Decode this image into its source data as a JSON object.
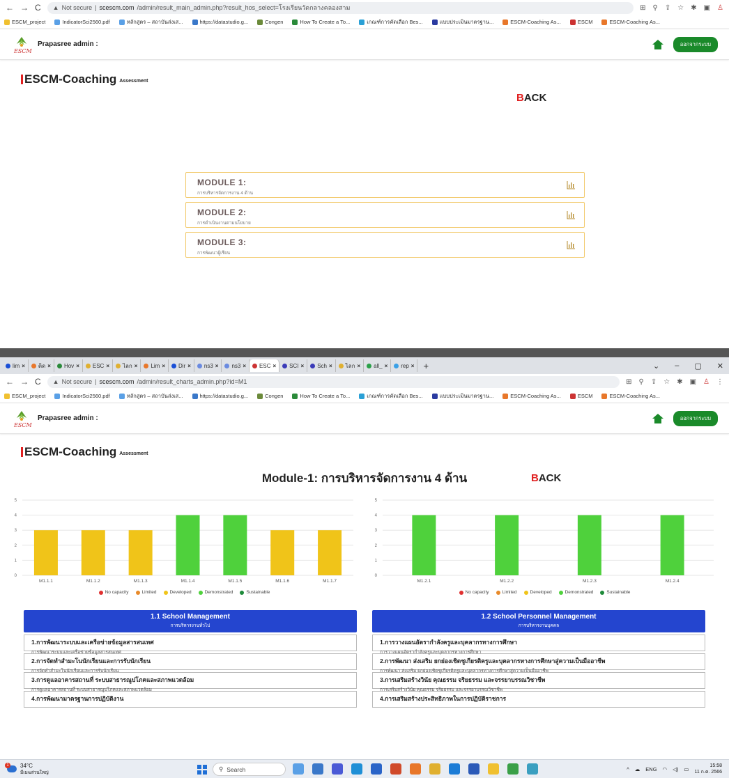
{
  "shot1": {
    "url_insecure": "Not secure",
    "url_host": "scescm.com",
    "url_path": "/admin/result_main_admin.php?result_hos_select=โรงเรียนวัดกลางคลองสาม",
    "bookmarks": [
      "ESCM_project",
      "IndicatorSci2560.pdf",
      "หลักสูตร – สถาบันส่งเส...",
      "https://datastudio.g...",
      "Congen",
      "How To Create a To...",
      "เกณฑ์การคัดเลือก Bes...",
      "แบบประเมินมาตรฐาน...",
      "ESCM-Coaching As...",
      "ESCM",
      "ESCM-Coaching As..."
    ],
    "admin_label": "Prapasree admin :",
    "logout_label": "ออกจากระบบ",
    "brand_name": "ESCM-Coaching",
    "brand_sub": "Assessment",
    "back_first": "B",
    "back_rest": "ACK",
    "modules": [
      {
        "title": "MODULE 1:",
        "subtitle": "การบริหารจัดการงาน 4 ด้าน"
      },
      {
        "title": "MODULE 2:",
        "subtitle": "การดำเนินงานตามนโยบาย"
      },
      {
        "title": "MODULE 3:",
        "subtitle": "การพัฒนาผู้เรียน"
      }
    ]
  },
  "shot2": {
    "tabs": [
      "lim",
      "ติด",
      "Hov",
      "ESC",
      "ไลก",
      "Lim",
      "Dir",
      "ns3",
      "ns3",
      "ESC",
      "SCI",
      "Sch",
      "ไลก",
      "all_",
      "rep"
    ],
    "url_insecure": "Not secure",
    "url_host": "scescm.com",
    "url_path": "/admin/result_charts_admin.php?id=M1",
    "bookmarks": [
      "ESCM_project",
      "IndicatorSci2560.pdf",
      "หลักสูตร – สถาบันส่งเส...",
      "https://datastudio.g...",
      "Congen",
      "How To Create a To...",
      "เกณฑ์การคัดเลือก Bes...",
      "แบบประเมินมาตรฐาน...",
      "ESCM-Coaching As...",
      "ESCM",
      "ESCM-Coaching As..."
    ],
    "admin_label": "Prapasree admin :",
    "logout_label": "ออกจากระบบ",
    "brand_name": "ESCM-Coaching",
    "brand_sub": "Assessment",
    "back_first": "B",
    "back_rest": "ACK",
    "page_title": "Module-1: การบริหารจัดการงาน 4 ด้าน",
    "legend": [
      {
        "label": "No capacity",
        "color": "#e03030"
      },
      {
        "label": "Limited",
        "color": "#e88a2a"
      },
      {
        "label": "Developed",
        "color": "#f0c419"
      },
      {
        "label": "Demonstrated",
        "color": "#4fd13c"
      },
      {
        "label": "Sustainable",
        "color": "#1e8a3a"
      }
    ],
    "categories": [
      {
        "title": "1.1 School Management",
        "subtitle": "การบริหารงานทั่วไป",
        "items": [
          {
            "t": "1.การพัฒนาระบบและเครือข่ายข้อมูลสารสนเทศ",
            "s": "การพัฒนาระบบและเครือข่ายข้อมูลสารสนเทศ"
          },
          {
            "t": "2.การจัดทำสำมะโนนักเรียนและการรับนักเรียน",
            "s": "การจัดทำสำมะโนนักเรียนและการรับนักเรียน"
          },
          {
            "t": "3.การดูแลอาคารสถานที่ ระบบสาธารณูปโภคและสภาพแวดล้อม",
            "s": "การดูแลอาคารสถานที่ ระบบสาธารณูปโภคและสภาพแวดล้อม"
          },
          {
            "t": "4.การพัฒนามาตรฐานการปฏิบัติงาน",
            "s": ""
          }
        ]
      },
      {
        "title": "1.2 School Personnel Management",
        "subtitle": "การบริหารงานบุคคล",
        "items": [
          {
            "t": "1.การวางแผนอัตรากำลังครูและบุคลากรทางการศึกษา",
            "s": "การวางแผนอัตรากำลังครูและบุคลากรทางการศึกษา"
          },
          {
            "t": "2.การพัฒนา ส่งเสริม ยกย่องเชิดชูเกียรติครูและบุคลากรทางการศึกษาสู่ความเป็นมืออาชีพ",
            "s": "การพัฒนา ส่งเสริม ยกย่องเชิดชูเกียรติครูและบุคลากรทางการศึกษาสู่ความเป็นมืออาชีพ"
          },
          {
            "t": "3.การเสริมสร้างวินัย คุณธรรม จริยธรรม และจรรยาบรรณวิชาชีพ",
            "s": "การเสริมสร้างวินัย คุณธรรม จริยธรรม และจรรยาบรรณวิชาชีพ"
          },
          {
            "t": "4.การเสริมสร้างประสิทธิภาพในการปฏิบัติราชการ",
            "s": ""
          }
        ]
      }
    ],
    "taskbar": {
      "temp": "34°C",
      "weather": "มีเมฆส่วนใหญ่",
      "search": "Search",
      "lang": "ENG",
      "time": "15:58",
      "date": "11 ก.ค. 2566"
    }
  },
  "chart_data": [
    {
      "type": "bar",
      "categories": [
        "M1.1.1",
        "M1.1.2",
        "M1.1.3",
        "M1.1.4",
        "M1.1.5",
        "M1.1.6",
        "M1.1.7"
      ],
      "values": [
        3,
        3,
        3,
        4,
        4,
        3,
        3
      ],
      "colors": [
        "#f0c419",
        "#f0c419",
        "#f0c419",
        "#4fd13c",
        "#4fd13c",
        "#f0c419",
        "#f0c419"
      ],
      "ylim": [
        0,
        5
      ],
      "yticks": [
        0,
        1,
        2,
        3,
        4,
        5
      ],
      "grid": true
    },
    {
      "type": "bar",
      "categories": [
        "M1.2.1",
        "M1.2.2",
        "M1.2.3",
        "M1.2.4"
      ],
      "values": [
        4,
        4,
        4,
        4
      ],
      "colors": [
        "#4fd13c",
        "#4fd13c",
        "#4fd13c",
        "#4fd13c"
      ],
      "ylim": [
        0,
        5
      ],
      "yticks": [
        0,
        1,
        2,
        3,
        4,
        5
      ],
      "grid": true
    }
  ]
}
